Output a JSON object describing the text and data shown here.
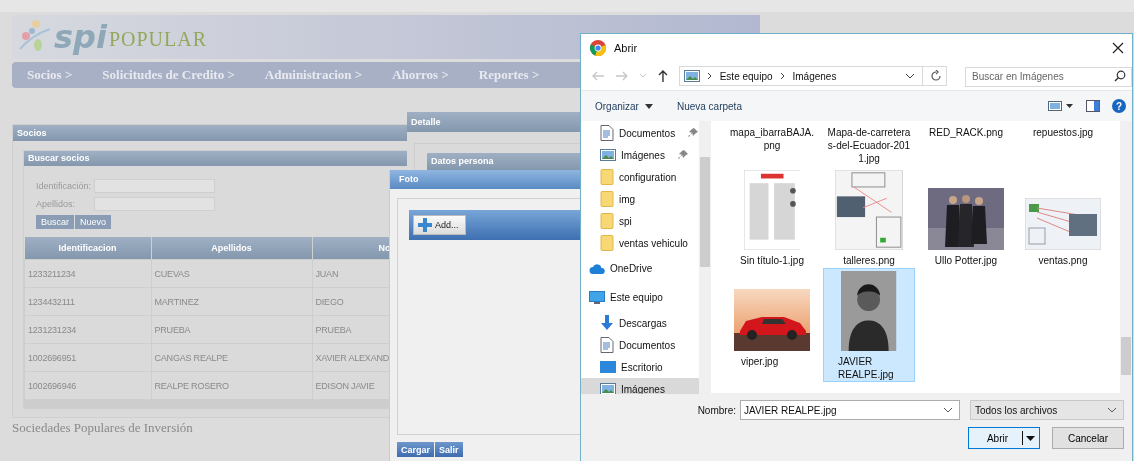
{
  "app": {
    "logo": {
      "mark": "spi",
      "name": "POPULAR"
    },
    "menu": [
      "Socios >",
      "Solicitudes de Credito >",
      "Administracion >",
      "Ahorros >",
      "Reportes >"
    ],
    "socios_panel": {
      "title": "Socios",
      "search": {
        "title": "Buscar socios",
        "fields": [
          {
            "label": "Identificación:"
          },
          {
            "label": "Apellidos:"
          }
        ],
        "buttons": [
          "Buscar",
          "Nuevo"
        ]
      },
      "table": {
        "columns": [
          "Identificacion",
          "Apellidos",
          "No"
        ],
        "rows": [
          [
            "1233211234",
            "CUEVAS",
            "JUAN"
          ],
          [
            "1234432111",
            "MARTINEZ",
            "DIEGO"
          ],
          [
            "1231231234",
            "PRUEBA",
            "PRUEBA"
          ],
          [
            "1002696951",
            "CANGAS REALPE",
            "XAVIER ALEXAND"
          ],
          [
            "1002696946",
            "REALPE ROSERO",
            "EDISON JAVIE"
          ]
        ]
      }
    },
    "footer": "Sociedades Populares de Inversión"
  },
  "detalle": {
    "title": "Detalle",
    "section": "Datos persona"
  },
  "foto": {
    "title": "Foto",
    "add_button": "Add...",
    "buttons": [
      "Cargar",
      "Salir"
    ]
  },
  "file_dialog": {
    "title": "Abrir",
    "back_enabled": false,
    "forward_enabled": false,
    "path": [
      "Este equipo",
      "Imágenes"
    ],
    "search": {
      "placeholder": "Buscar en Imágenes"
    },
    "toolbar": {
      "organize": "Organizar",
      "new_folder": "Nueva carpeta",
      "help": "?"
    },
    "quick_access": [
      {
        "label": "Documentos",
        "kind": "document",
        "pinned": true,
        "selected": false
      },
      {
        "label": "Imágenes",
        "kind": "pictures",
        "pinned": true,
        "selected": false
      },
      {
        "label": "configuration",
        "kind": "folder",
        "pinned": false,
        "selected": false
      },
      {
        "label": "img",
        "kind": "folder",
        "pinned": false,
        "selected": false
      },
      {
        "label": "spi",
        "kind": "folder",
        "pinned": false,
        "selected": false
      },
      {
        "label": "ventas vehiculo",
        "kind": "folder",
        "pinned": false,
        "selected": false
      }
    ],
    "nav": [
      {
        "label": "OneDrive",
        "kind": "cloud",
        "selected": false
      },
      {
        "label": "Este equipo",
        "kind": "computer",
        "selected": false,
        "children": [
          {
            "label": "Descargas",
            "kind": "download",
            "selected": false
          },
          {
            "label": "Documentos",
            "kind": "document",
            "selected": false
          },
          {
            "label": "Escritorio",
            "kind": "desktop",
            "selected": false
          },
          {
            "label": "Imágenes",
            "kind": "pictures",
            "selected": true
          }
        ]
      }
    ],
    "files": [
      {
        "name": "mapa_ibarraBAJA.png",
        "selected": false
      },
      {
        "name": "Mapa-de-carreteras-del-Ecuador-2011.jpg",
        "selected": false
      },
      {
        "name": "RED_RACK.png",
        "selected": false
      },
      {
        "name": "repuestos.jpg",
        "selected": false
      },
      {
        "name": "Sin título-1.jpg",
        "kind": "picture",
        "selected": false
      },
      {
        "name": "talleres.png",
        "kind": "picture",
        "selected": false
      },
      {
        "name": "Ullo Potter.jpg",
        "kind": "picture",
        "selected": false
      },
      {
        "name": "ventas.png",
        "kind": "picture",
        "selected": false
      },
      {
        "name": "viper.jpg",
        "kind": "picture",
        "selected": false
      },
      {
        "name": "JAVIER REALPE.jpg",
        "kind": "picture",
        "selected": true
      }
    ],
    "filename": {
      "label": "Nombre:",
      "value": "JAVIER REALPE.jpg"
    },
    "filter": "Todos los archivos",
    "buttons": {
      "open": "Abrir",
      "cancel": "Cancelar"
    }
  }
}
